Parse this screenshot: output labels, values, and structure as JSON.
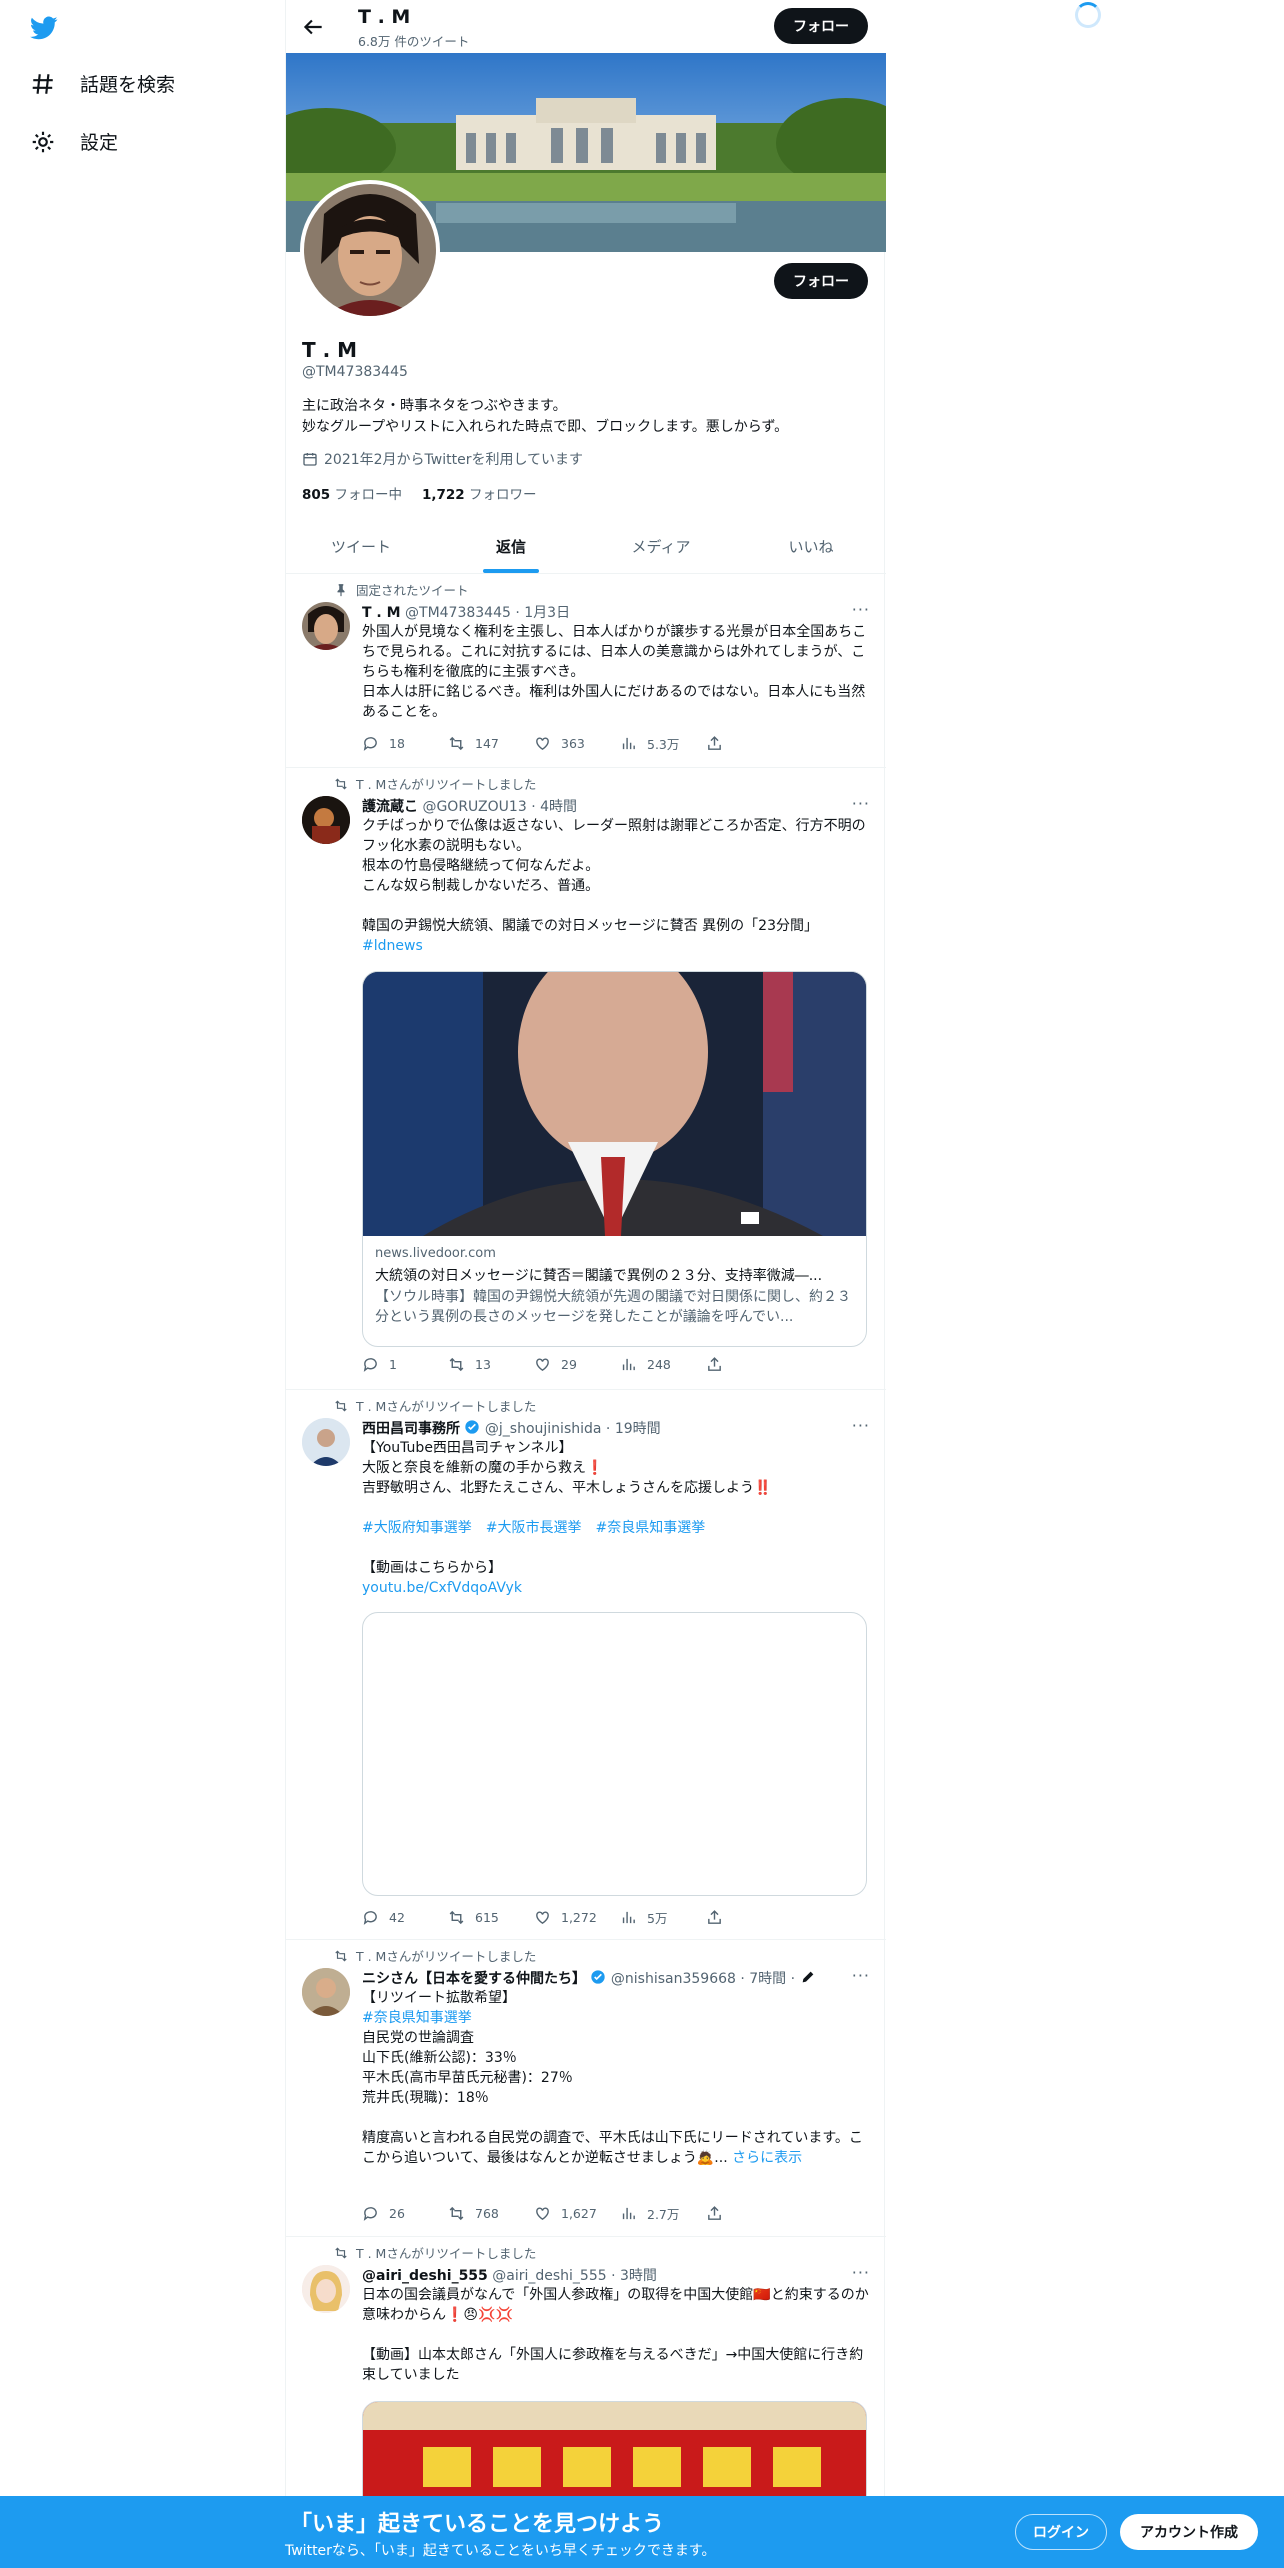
{
  "nav": {
    "explore": "話題を検索",
    "settings": "設定"
  },
  "topbar": {
    "title": "T . M",
    "tweet_count": "6.8万 件のツイート",
    "follow": "フォロー"
  },
  "profile": {
    "follow": "フォロー",
    "name": "T . M",
    "handle": "@TM47383445",
    "bio_line1": "主に政治ネタ・時事ネタをつぶやきます。",
    "bio_line2": "妙なグループやリストに入れられた時点で即、ブロックします。悪しからず。",
    "joined": "2021年2月からTwitterを利用しています",
    "following_count": "805",
    "following_label": "フォロー中",
    "followers_count": "1,722",
    "followers_label": "フォロワー"
  },
  "tabs": [
    "ツイート",
    "返信",
    "メディア",
    "いいね"
  ],
  "tweets": [
    {
      "social": "固定されたツイート",
      "name": "T . M",
      "handle": "@TM47383445",
      "time": "· 1月3日",
      "text": "外国人が見境なく権利を主張し、日本人ばかりが譲歩する光景が日本全国あちこちで見られる。これに対抗するには、日本人の美意識からは外れてしまうが、こちらも権利を徹底的に主張すべき。\n日本人は肝に銘じるべき。権利は外国人にだけあるのではない。日本人にも当然あることを。",
      "replies": "18",
      "retweets": "147",
      "likes": "363",
      "views": "5.3万"
    },
    {
      "social": "T . Mさんがリツイートしました",
      "name": "護流蔵こ",
      "handle": "@GORUZOU13",
      "time": "· 4時間",
      "text": "クチばっかりで仏像は返さない、レーダー照射は謝罪どころか否定、行方不明のフッ化水素の説明もない。\n根本の竹島侵略継続って何なんだよ。\nこんな奴ら制裁しかないだろ、普通。\n\n韓国の尹錫悦大統領、閣議での対日メッセージに賛否 異例の「23分間」",
      "hashtag": "#ldnews",
      "card_domain": "news.livedoor.com",
      "card_title": "大統領の対日メッセージに賛否＝閣議で異例の２３分、支持率微減―...",
      "card_desc": "【ソウル時事】韓国の尹錫悦大統領が先週の閣議で対日関係に関し、約２３分という異例の長さのメッセージを発したことが議論を呼んでい...",
      "replies": "1",
      "retweets": "13",
      "likes": "29",
      "views": "248"
    },
    {
      "social": "T . Mさんがリツイートしました",
      "name": "西田昌司事務所",
      "handle": "@j_shoujinishida",
      "time": "· 19時間",
      "text": "【YouTube西田昌司チャンネル】\n大阪と奈良を維新の魔の手から救え❗️\n吉野敏明さん、北野たえこさん、平木しょうさんを応援しよう‼️",
      "hashtags": [
        "#大阪府知事選挙",
        "#大阪市長選挙",
        "#奈良県知事選挙"
      ],
      "text2": "【動画はこちらから】",
      "link": "youtu.be/CxfVdqoAVyk",
      "replies": "42",
      "retweets": "615",
      "likes": "1,272",
      "views": "5万"
    },
    {
      "social": "T . Mさんがリツイートしました",
      "name": "ニシさん【日本を愛する仲間たち】",
      "handle": "@nishisan359668",
      "time": "· 7時間 ·",
      "text_head": "【リツイート拡散希望】",
      "hashtag": "#奈良県知事選挙",
      "text": "自民党の世論調査\n山下氏(維新公認)：33％\n平木氏(高市早苗氏元秘書)：27％\n荒井氏(現職)：18％\n\n精度高いと言われる自民党の調査で、平木氏は山下氏にリードされています。ここから追いついて、最後はなんとか逆転させましょう🙇...",
      "show_more": "さらに表示",
      "replies": "26",
      "retweets": "768",
      "likes": "1,627",
      "views": "2.7万"
    },
    {
      "social": "T . Mさんがリツイートしました",
      "name": "@airi_deshi_555",
      "handle": "@airi_deshi_555",
      "time": "· 3時間",
      "text": "日本の国会議員がなんで「外国人参政権」の取得を中国大使館🇨🇳と約束するのか意味わからん❗😠💢💢\n\n【動画】山本太郎さん「外国人に参政権を与えるべきだ」→中国大使館に行き約束していました"
    }
  ],
  "bottom_bar": {
    "title": "「いま」起きていることを見つけよう",
    "subtitle": "Twitterなら、「いま」起きていることをいち早くチェックできます。",
    "login": "ログイン",
    "signup": "アカウント作成"
  },
  "colors": {
    "accent": "#1d9bf0",
    "dark": "#0f1419",
    "muted": "#536471"
  }
}
